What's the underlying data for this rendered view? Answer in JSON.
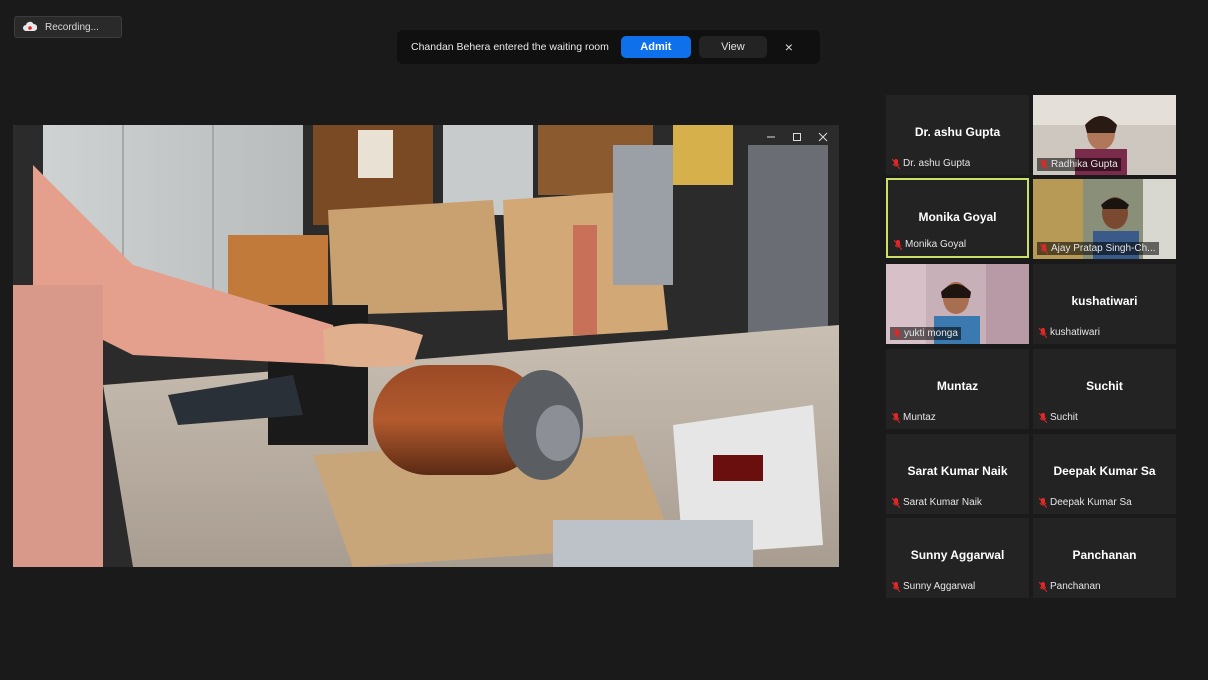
{
  "recording": {
    "label": "Recording..."
  },
  "notification": {
    "message": "Chandan Behera entered the waiting room",
    "admit_label": "Admit",
    "view_label": "View",
    "close_label": "×"
  },
  "gallery": [
    {
      "display": "Dr. ashu Gupta",
      "label": "Dr. ashu Gupta",
      "photo": false,
      "active": false
    },
    {
      "display": "",
      "label": "Radhika Gupta",
      "photo": true,
      "active": false
    },
    {
      "display": "Monika Goyal",
      "label": "Monika Goyal",
      "photo": false,
      "active": true
    },
    {
      "display": "",
      "label": "Ajay Pratap Singh-Ch...",
      "photo": true,
      "active": false
    },
    {
      "display": "",
      "label": "yukti monga",
      "photo": true,
      "active": false
    },
    {
      "display": "kushatiwari",
      "label": "kushatiwari",
      "photo": false,
      "active": false
    },
    {
      "display": "Muntaz",
      "label": "Muntaz",
      "photo": false,
      "active": false
    },
    {
      "display": "Suchit",
      "label": "Suchit",
      "photo": false,
      "active": false
    },
    {
      "display": "Sarat Kumar Naik",
      "label": "Sarat Kumar Naik",
      "photo": false,
      "active": false
    },
    {
      "display": "Deepak Kumar Sa",
      "label": "Deepak Kumar Sa",
      "photo": false,
      "active": false
    },
    {
      "display": "Sunny Aggarwal",
      "label": "Sunny Aggarwal",
      "photo": false,
      "active": false
    },
    {
      "display": "Panchanan",
      "label": "Panchanan",
      "photo": false,
      "active": false
    }
  ],
  "colors": {
    "accent": "#0e71eb",
    "active_border": "#c9e265",
    "muted_mic": "#e02828"
  }
}
